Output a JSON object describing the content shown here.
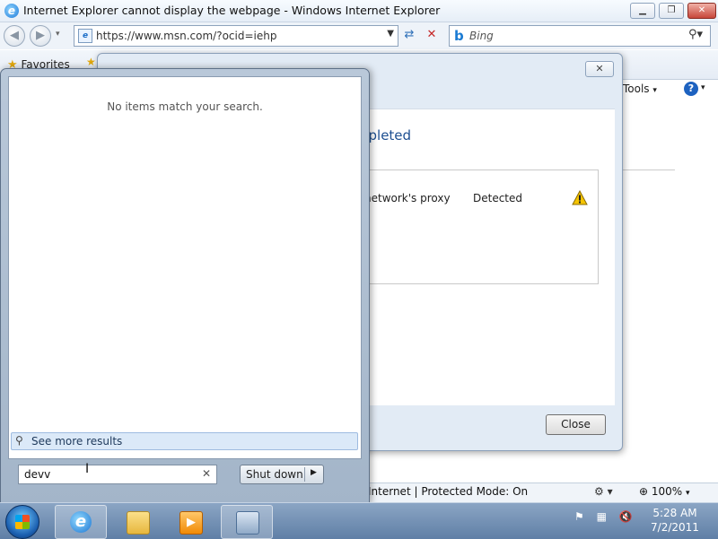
{
  "ie": {
    "title": "Internet Explorer cannot display the webpage - Windows Internet Explorer",
    "address": "https://www.msn.com/?ocid=iehp",
    "search_placeholder": "Bing",
    "favorites_label": "Favorites",
    "tools_label": "Tools",
    "status_zone": "Internet | Protected Mode: On",
    "zoom": "100%"
  },
  "dialog": {
    "heading_partial": "npleted",
    "result_label": "network's proxy",
    "result_status": "Detected",
    "close_button": "Close"
  },
  "start_menu": {
    "no_items": "No items match your search.",
    "see_more": "See more results",
    "search_value": "devv",
    "shutdown_label": "Shut down"
  },
  "taskbar": {
    "time": "5:28 AM",
    "date": "7/2/2011",
    "items": [
      "internet-explorer",
      "windows-explorer",
      "media-player",
      "network-diagnostics"
    ]
  }
}
